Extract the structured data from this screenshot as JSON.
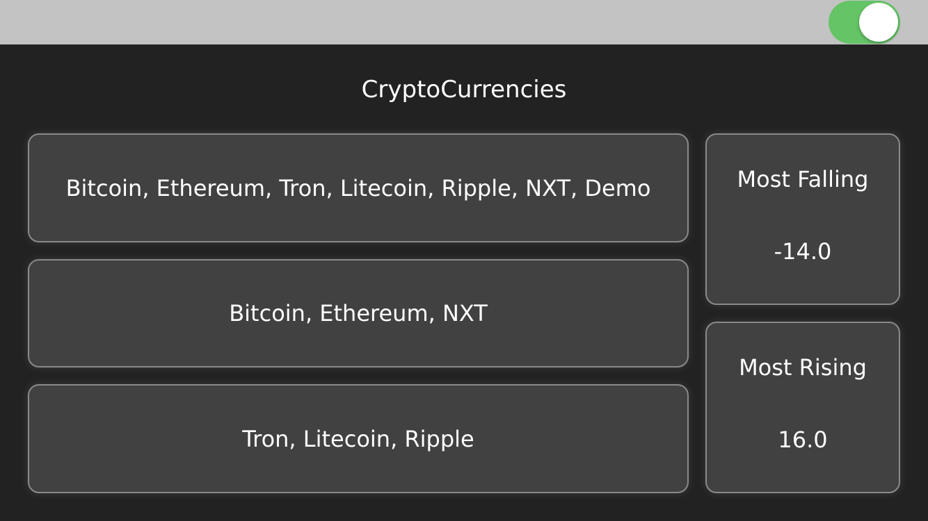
{
  "header": {
    "toggle": {
      "state": "on",
      "color": "#65c466"
    }
  },
  "main": {
    "title": "CryptoCurrencies",
    "lists": [
      {
        "label": "Bitcoin, Ethereum, Tron, Litecoin, Ripple, NXT, Demo"
      },
      {
        "label": "Bitcoin, Ethereum, NXT"
      },
      {
        "label": "Tron, Litecoin, Ripple"
      }
    ],
    "stats": {
      "falling": {
        "label": "Most Falling",
        "value": "-14.0"
      },
      "rising": {
        "label": "Most Rising",
        "value": "16.0"
      }
    }
  }
}
